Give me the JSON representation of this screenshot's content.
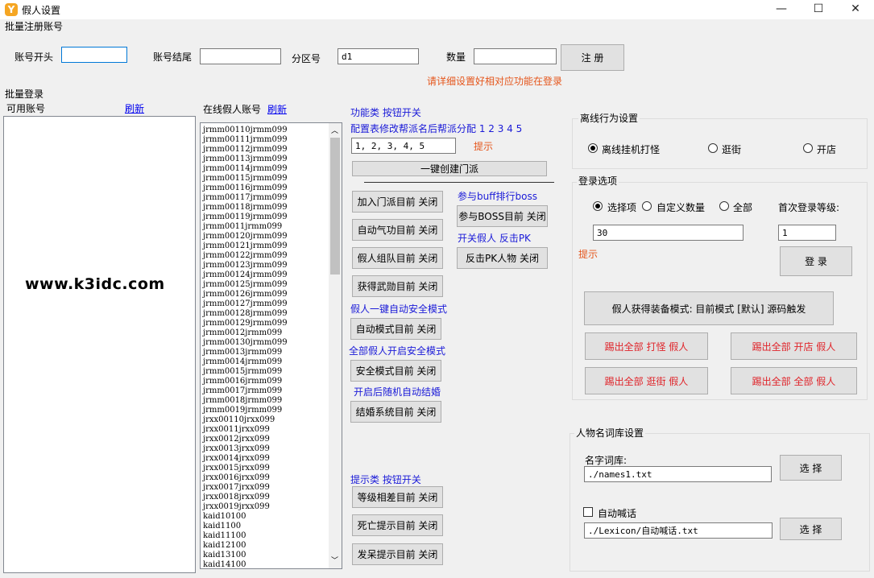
{
  "window": {
    "title": "假人设置",
    "icon_letter": "Y",
    "minimize": "—",
    "maximize": "☐",
    "close": "✕"
  },
  "batch_register": {
    "title": "批量注册账号",
    "prefix_label": "账号开头",
    "prefix_value": "",
    "suffix_label": "账号结尾",
    "suffix_value": "",
    "zone_label": "分区号",
    "zone_value": "d1",
    "count_label": "数量",
    "count_value": "",
    "register_button": "注 册",
    "hint": "请详细设置好相对应功能在登录"
  },
  "batch_login": {
    "title": "批量登录",
    "available_label": "可用账号",
    "refresh_label": "刷新",
    "watermark": "www.k3idc.com"
  },
  "online": {
    "label": "在线假人账号",
    "refresh_label": "刷新",
    "accounts": [
      "jrmm00110jrmm099",
      "jrmm00111jrmm099",
      "jrmm00112jrmm099",
      "jrmm00113jrmm099",
      "jrmm00114jrmm099",
      "jrmm00115jrmm099",
      "jrmm00116jrmm099",
      "jrmm00117jrmm099",
      "jrmm00118jrmm099",
      "jrmm00119jrmm099",
      "jrmm0011jrmm099",
      "jrmm00120jrmm099",
      "jrmm00121jrmm099",
      "jrmm00122jrmm099",
      "jrmm00123jrmm099",
      "jrmm00124jrmm099",
      "jrmm00125jrmm099",
      "jrmm00126jrmm099",
      "jrmm00127jrmm099",
      "jrmm00128jrmm099",
      "jrmm00129jrmm099",
      "jrmm0012jrmm099",
      "jrmm00130jrmm099",
      "jrmm0013jrmm099",
      "jrmm0014jrmm099",
      "jrmm0015jrmm099",
      "jrmm0016jrmm099",
      "jrmm0017jrmm099",
      "jrmm0018jrmm099",
      "jrmm0019jrmm099",
      "jrxx00110jrxx099",
      "jrxx0011jrxx099",
      "jrxx0012jrxx099",
      "jrxx0013jrxx099",
      "jrxx0014jrxx099",
      "jrxx0015jrxx099",
      "jrxx0016jrxx099",
      "jrxx0017jrxx099",
      "jrxx0018jrxx099",
      "jrxx0019jrxx099",
      "kaid10100",
      "kaid1100",
      "kaid11100",
      "kaid12100",
      "kaid13100",
      "kaid14100"
    ]
  },
  "functions": {
    "header": "功能类 按钮开关",
    "config_label": "配置表修改帮派名后帮派分配 1 2 3 4 5",
    "config_value": "1, 2, 3, 4, 5",
    "hint": "提示",
    "create_sect": "一键创建门派",
    "join_sect": "加入门派目前 关闭",
    "auto_qigong": "自动气功目前 关闭",
    "team": "假人组队目前 关闭",
    "merit": "获得武勋目前 关闭",
    "safe_label1": "假人一键自动安全模式",
    "auto_mode": "自动模式目前 关闭",
    "safe_label2": "全部假人开启安全模式",
    "safe_mode": "安全模式目前 关闭",
    "marry_label": "开启后随机自动结婚",
    "marry": "结婚系统目前 关闭",
    "boss_label": "参与buff排行boss",
    "boss": "参与BOSS目前 关闭",
    "pk_label": "开关假人 反击PK",
    "pk": "反击PK人物 关闭",
    "tip_header": "提示类 按钮开关",
    "level_tip": "等级相差目前 关闭",
    "death_tip": "死亡提示目前 关闭",
    "idle_tip": "发呆提示目前 关闭"
  },
  "offline": {
    "title": "离线行为设置",
    "options": [
      "离线挂机打怪",
      "逛街",
      "开店"
    ],
    "selected": "离线挂机打怪"
  },
  "login": {
    "title": "登录选项",
    "options": [
      "选择项",
      "自定义数量",
      "全部"
    ],
    "selected": "选择项",
    "first_level_label": "首次登录等级:",
    "count_value": "30",
    "level_value": "1",
    "hint": "提示",
    "login_button": "登 录",
    "equip_mode": "假人获得装备模式:  目前模式 [默认] 源码触发",
    "kick_monster": "踢出全部 打怪 假人",
    "kick_shop": "踢出全部 开店 假人",
    "kick_walk": "踢出全部 逛街 假人",
    "kick_all": "踢出全部 全部 假人"
  },
  "names": {
    "title": "人物名词库设置",
    "lib_label": "名字词库:",
    "lib_value": "./names1.txt",
    "choose_button": "选 择",
    "auto_shout_label": "自动喊话",
    "auto_shout_checked": false,
    "shout_value": "./Lexicon/自动喊话.txt",
    "choose_button2": "选 择"
  }
}
